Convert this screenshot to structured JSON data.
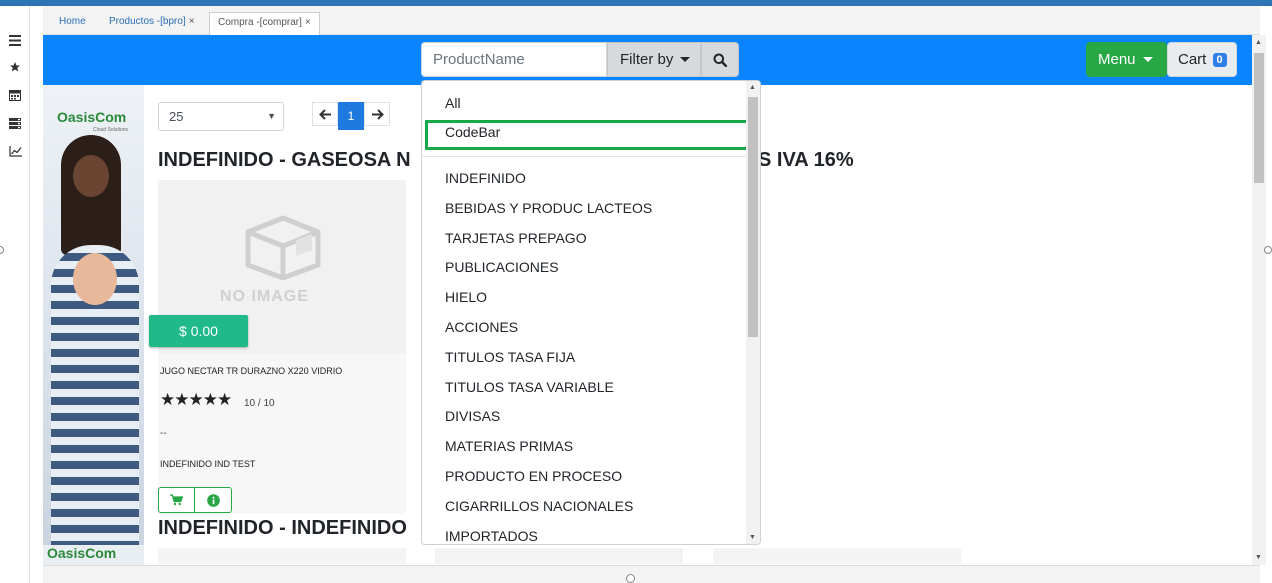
{
  "tabs": [
    {
      "label": "Home",
      "closable": false,
      "active": false
    },
    {
      "label": "Productos -[bpro]",
      "closable": true,
      "active": false
    },
    {
      "label": "Compra -[comprar]",
      "closable": true,
      "active": true
    }
  ],
  "tab_close_glyph": "×",
  "sidebar_icons": [
    "menu-icon",
    "star-icon",
    "calendar-icon",
    "list-icon",
    "chart-line-icon"
  ],
  "navbar": {
    "color": "#0b84ff",
    "search_placeholder": "ProductName",
    "filter_label": "Filter by",
    "menu_label": "Menu",
    "cart_label": "Cart",
    "cart_count": "0"
  },
  "promo": {
    "logo": "OasisCom",
    "tagline": "Cloud Solutions"
  },
  "pagination": {
    "page_size": "25",
    "current_page": "1"
  },
  "sections": [
    {
      "heading_visible_left": "INDEFINIDO - GASEOSA N",
      "heading_visible_right": "S IVA 16%"
    },
    {
      "heading_visible_left": "INDEFINIDO - INDEFINIDO"
    }
  ],
  "product_card": {
    "no_image_text": "NO IMAGE",
    "price": "$ 0.00",
    "name": "JUGO NECTAR TR DURAZNO X220 VIDRIO",
    "stars": "★★★★★",
    "rating": "10 / 10",
    "dash": "--",
    "category": "INDEFINIDO IND TEST"
  },
  "filter_dropdown": {
    "top_items": [
      "All",
      "CodeBar"
    ],
    "highlighted": "CodeBar",
    "highlight_color": "#17a84a",
    "category_items": [
      "INDEFINIDO",
      "BEBIDAS Y PRODUC LACTEOS",
      "TARJETAS PREPAGO",
      "PUBLICACIONES",
      "HIELO",
      "ACCIONES",
      "TITULOS TASA FIJA",
      "TITULOS TASA VARIABLE",
      "DIVISAS",
      "MATERIAS PRIMAS",
      "PRODUCTO EN PROCESO",
      "CIGARRILLOS NACIONALES",
      "IMPORTADOS"
    ]
  }
}
